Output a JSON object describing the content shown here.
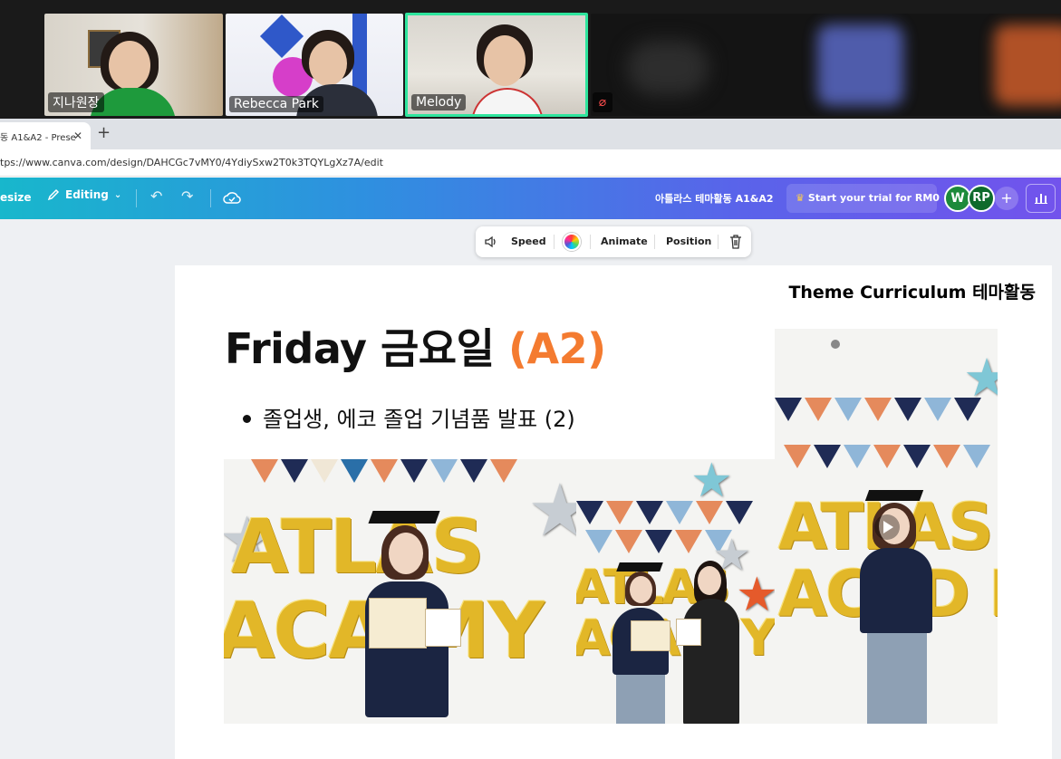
{
  "video_call": {
    "participants": [
      {
        "name": "지나원장"
      },
      {
        "name": "Rebecca Park"
      },
      {
        "name": "Melody"
      }
    ],
    "muted_icon": "mic-off-icon"
  },
  "browser": {
    "tab_title": "동 A1&A2 - Prese",
    "url": "tps://www.canva.com/design/DAHCGc7vMY0/4YdiySxw2T0k3TQYLgXz7A/edit"
  },
  "canva_toolbar": {
    "resize_label": "esize",
    "editing_label": "Editing",
    "doc_title": "아틀라스 테마활동 A1&A2",
    "trial_label": "Start your trial for RM0",
    "avatars": [
      "W",
      "RP"
    ],
    "colors": {
      "gradient_start": "#18b7cc",
      "gradient_end": "#7253ec"
    }
  },
  "floating_toolbar": {
    "speed_label": "Speed",
    "animate_label": "Animate",
    "position_label": "Position"
  },
  "slide": {
    "header": "Theme Curriculum 테마활동",
    "title_main": "Friday 금요일 ",
    "title_accent": "(A2)",
    "bullet": "졸업생, 에코 졸업 기념품 발표 (2)",
    "accent_color": "#f47b30"
  }
}
